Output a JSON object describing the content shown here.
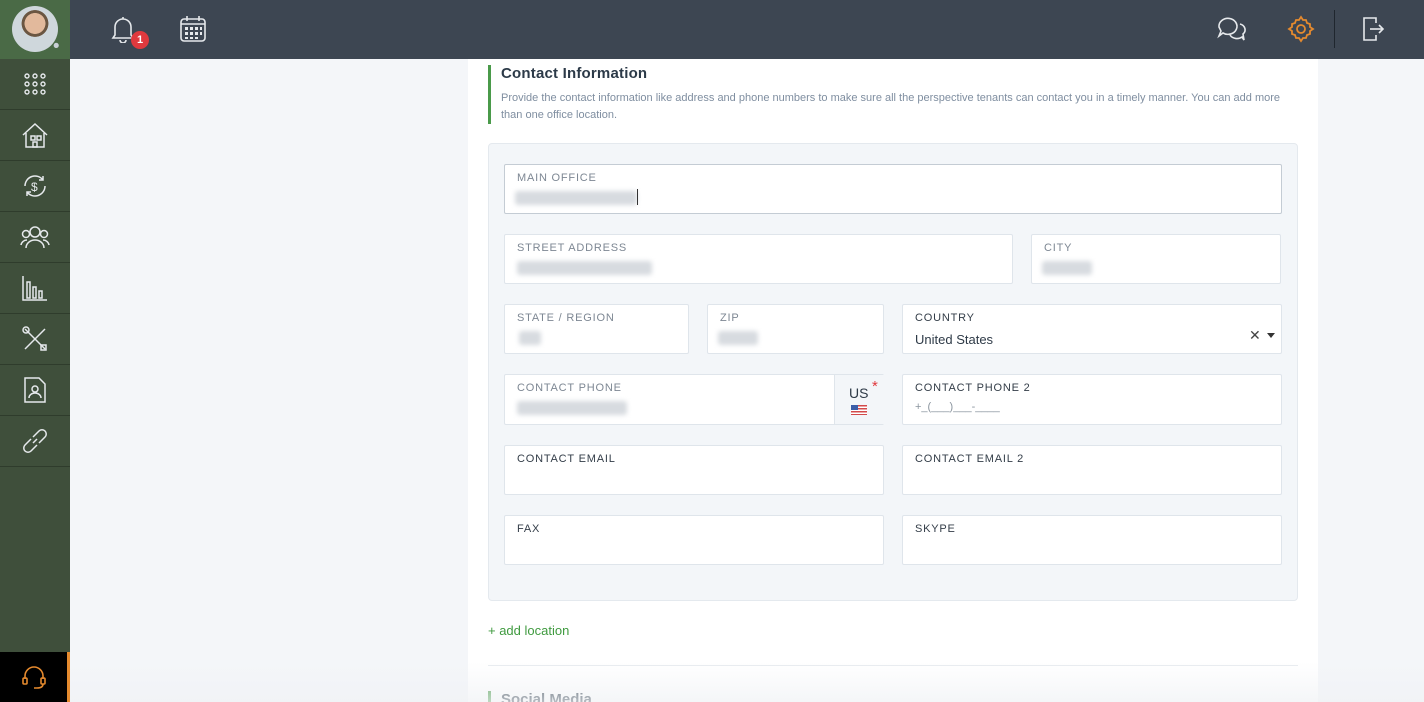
{
  "topbar": {
    "notifications_count": "1"
  },
  "section": {
    "title": "Contact Information",
    "description": "Provide the contact information like address and phone numbers to make sure all the perspective tenants can contact you in a timely manner. You can add more than one office location."
  },
  "form": {
    "main_office_label": "MAIN OFFICE",
    "street_label": "STREET ADDRESS",
    "city_label": "CITY",
    "state_label": "STATE / REGION",
    "zip_label": "ZIP",
    "country_label": "COUNTRY",
    "country_value": "United States",
    "phone_label": "CONTACT PHONE",
    "phone_country_code": "US",
    "required_mark": "*",
    "phone2_label": "CONTACT PHONE 2",
    "phone2_placeholder": "+_(___)___-____",
    "email_label": "CONTACT EMAIL",
    "email2_label": "CONTACT EMAIL 2",
    "fax_label": "FAX",
    "skype_label": "SKYPE",
    "clear_symbol": "✕"
  },
  "actions": {
    "add_location": "+ add location"
  },
  "next_section": {
    "title": "Social Media"
  },
  "icons": {
    "bell": "bell-icon",
    "calendar": "calendar-icon",
    "chat": "chat-icon",
    "settings": "gear-icon",
    "logout": "logout-icon"
  },
  "colors": {
    "topbar": "#3d4652",
    "sidebar": "#3f4f3b",
    "accent_green": "#4a9a4a",
    "settings_orange": "#e58a2e",
    "badge_red": "#e0393e"
  }
}
